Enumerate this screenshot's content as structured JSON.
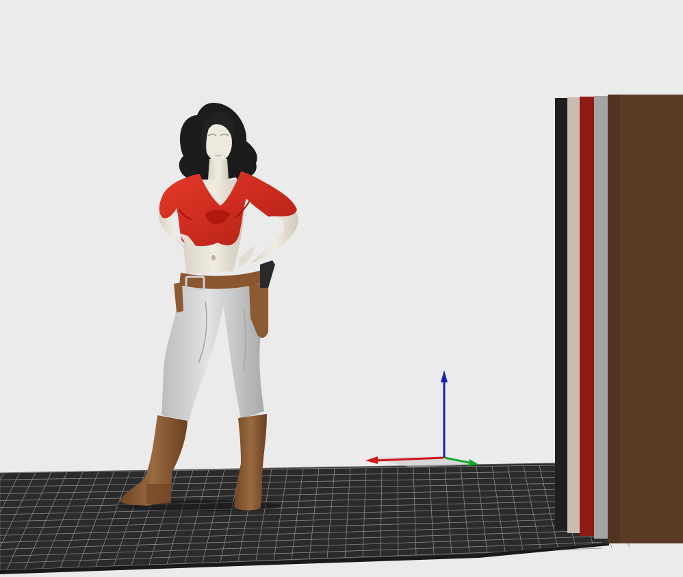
{
  "viewport": {
    "background": "#ebebeb",
    "build_plate_color": "#2b2b2b",
    "grid_line_color": "#8a8a8a"
  },
  "axis_gizmo": {
    "x_axis_color": "#d01818",
    "y_axis_color": "#1aa82a",
    "z_axis_color": "#1520b8"
  },
  "model": {
    "name_icon": "figurine-model",
    "colors": {
      "skin": "#ece7dc",
      "hair": "#1c1c1c",
      "shirt": "#d42a1e",
      "pants": "#d6d6d6",
      "belt": "#8a5630",
      "boots": "#8c5a34",
      "gun": "#2a2a2a"
    }
  },
  "filament_swatch_block": {
    "stripes": [
      "#1f1f1f",
      "#c9bcae",
      "#8e1a14",
      "#a4a4a4",
      "#5a3b26"
    ]
  }
}
